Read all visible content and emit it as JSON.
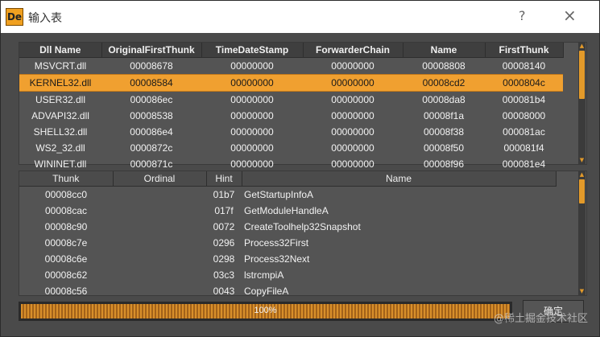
{
  "window": {
    "title": "输入表",
    "icon_text": "De",
    "help_label": "?",
    "close_label": "×"
  },
  "imports": {
    "columns": [
      "Dll Name",
      "OriginalFirstThunk",
      "TimeDateStamp",
      "ForwarderChain",
      "Name",
      "FirstThunk"
    ],
    "rows": [
      [
        "MSVCRT.dll",
        "00008678",
        "00000000",
        "00000000",
        "00008808",
        "00008140"
      ],
      [
        "KERNEL32.dll",
        "00008584",
        "00000000",
        "00000000",
        "00008cd2",
        "0000804c"
      ],
      [
        "USER32.dll",
        "000086ec",
        "00000000",
        "00000000",
        "00008da8",
        "000081b4"
      ],
      [
        "ADVAPI32.dll",
        "00008538",
        "00000000",
        "00000000",
        "00008f1a",
        "00008000"
      ],
      [
        "SHELL32.dll",
        "000086e4",
        "00000000",
        "00000000",
        "00008f38",
        "000081ac"
      ],
      [
        "WS2_32.dll",
        "0000872c",
        "00000000",
        "00000000",
        "00008f50",
        "000081f4"
      ],
      [
        "WININET.dll",
        "0000871c",
        "00000000",
        "00000000",
        "00008f96",
        "000081e4"
      ]
    ],
    "selected_index": 1
  },
  "functions": {
    "columns": [
      "Thunk",
      "Ordinal",
      "Hint",
      "Name"
    ],
    "rows": [
      [
        "00008cc0",
        "",
        "01b7",
        "GetStartupInfoA"
      ],
      [
        "00008cac",
        "",
        "017f",
        "GetModuleHandleA"
      ],
      [
        "00008c90",
        "",
        "0072",
        "CreateToolhelp32Snapshot"
      ],
      [
        "00008c7e",
        "",
        "0296",
        "Process32First"
      ],
      [
        "00008c6e",
        "",
        "0298",
        "Process32Next"
      ],
      [
        "00008c62",
        "",
        "03c3",
        "lstrcmpiA"
      ],
      [
        "00008c56",
        "",
        "0043",
        "CopyFileA"
      ]
    ]
  },
  "progress": {
    "label": "100%",
    "value": 1.0
  },
  "ok_button": {
    "label": "确定"
  },
  "watermark": "@稀土掘金技术社区",
  "colors": {
    "accent": "#f0a030",
    "panel_bg": "#545454",
    "window_bg": "#4a4a4a"
  }
}
